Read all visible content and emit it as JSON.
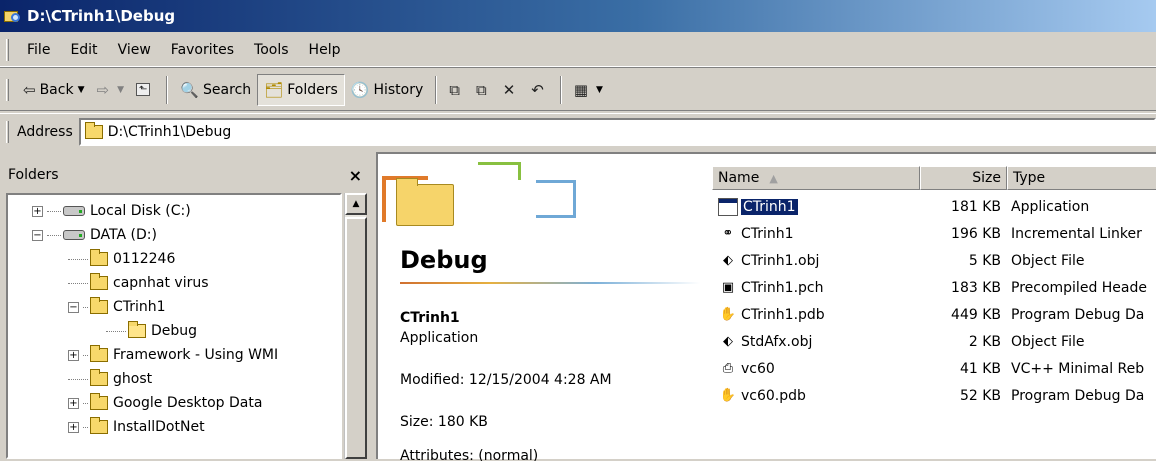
{
  "window": {
    "title": "D:\\CTrinh1\\Debug"
  },
  "menu": [
    "File",
    "Edit",
    "View",
    "Favorites",
    "Tools",
    "Help"
  ],
  "toolbar": {
    "back_label": "Back",
    "search_label": "Search",
    "folders_label": "Folders",
    "history_label": "History"
  },
  "address": {
    "label": "Address",
    "value": "D:\\CTrinh1\\Debug"
  },
  "folders_pane": {
    "title": "Folders",
    "close_label": "×",
    "items": [
      {
        "label": "Local Disk (C:)"
      },
      {
        "label": "DATA (D:)"
      },
      {
        "label": "0112246"
      },
      {
        "label": "capnhat virus"
      },
      {
        "label": "CTrinh1"
      },
      {
        "label": "Debug"
      },
      {
        "label": "Framework - Using WMI"
      },
      {
        "label": "ghost"
      },
      {
        "label": "Google Desktop Data"
      },
      {
        "label": "InstallDotNet"
      }
    ]
  },
  "details_panel": {
    "folder_title": "Debug",
    "selected_name": "CTrinh1",
    "selected_type": "Application",
    "modified": "Modified: 12/15/2004 4:28 AM",
    "size": "Size: 180 KB",
    "attributes": "Attributes: (normal)"
  },
  "file_list": {
    "columns": {
      "name": "Name",
      "size": "Size",
      "type": "Type"
    },
    "rows": [
      {
        "name": "CTrinh1",
        "size": "181 KB",
        "type": "Application",
        "icon": "application-icon"
      },
      {
        "name": "CTrinh1",
        "size": "196 KB",
        "type": "Incremental Linker",
        "icon": "linker-icon"
      },
      {
        "name": "CTrinh1.obj",
        "size": "5 KB",
        "type": "Object File",
        "icon": "object-file-icon"
      },
      {
        "name": "CTrinh1.pch",
        "size": "183 KB",
        "type": "Precompiled Heade",
        "icon": "precompiled-header-icon"
      },
      {
        "name": "CTrinh1.pdb",
        "size": "449 KB",
        "type": "Program Debug Da",
        "icon": "debug-database-icon"
      },
      {
        "name": "StdAfx.obj",
        "size": "2 KB",
        "type": "Object File",
        "icon": "object-file-icon"
      },
      {
        "name": "vc60",
        "size": "41 KB",
        "type": "VC++ Minimal Reb",
        "icon": "vc-rebuild-icon"
      },
      {
        "name": "vc60.pdb",
        "size": "52 KB",
        "type": "Program Debug Da",
        "icon": "debug-database-icon"
      }
    ]
  },
  "colors": {
    "title_bar": "#0a246a",
    "selection": "#0a246a",
    "chrome": "#d4d0c8"
  }
}
